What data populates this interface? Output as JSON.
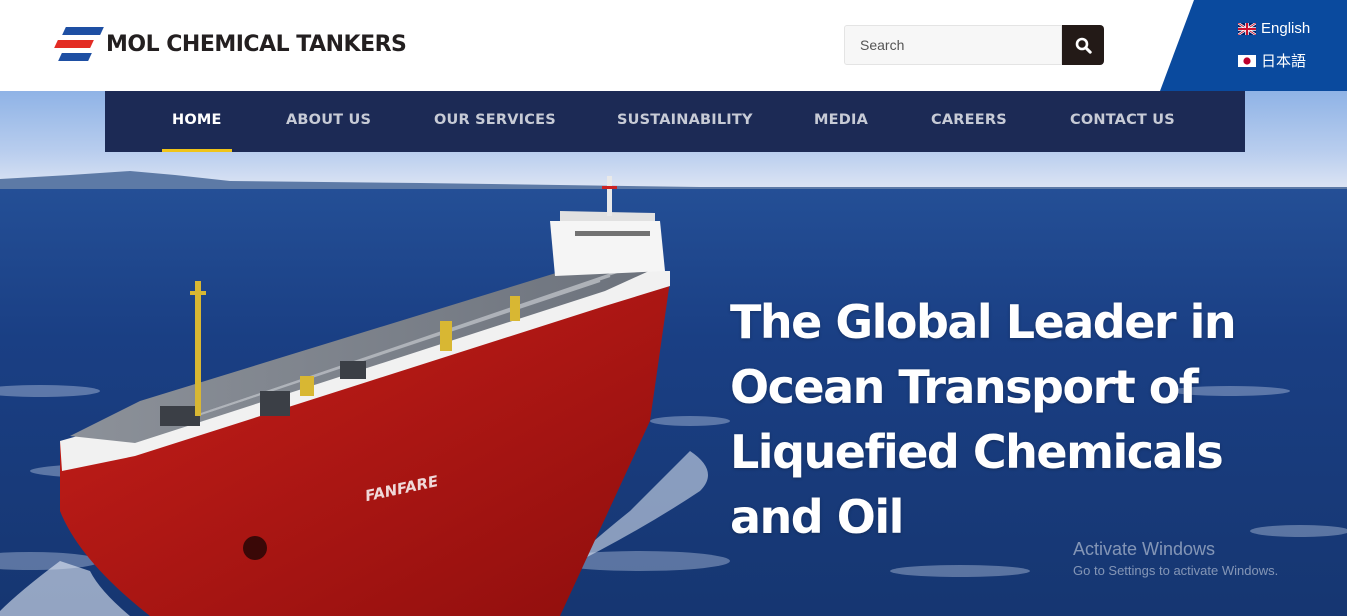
{
  "brand": {
    "name": "MOL CHEMICAL TANKERS",
    "colors": {
      "navy": "#1c2a55",
      "blue": "#0a4a9e",
      "red": "#e32c24",
      "accent": "#f0c419"
    }
  },
  "search": {
    "placeholder": "Search",
    "icon": "search-icon"
  },
  "languages": [
    {
      "label": "English",
      "icon": "uk-flag-icon"
    },
    {
      "label": "日本語",
      "icon": "japan-flag-icon"
    }
  ],
  "nav": {
    "items": [
      {
        "label": "HOME",
        "active": true
      },
      {
        "label": "ABOUT US"
      },
      {
        "label": "OUR SERVICES"
      },
      {
        "label": "SUSTAINABILITY"
      },
      {
        "label": "MEDIA"
      },
      {
        "label": "CAREERS"
      },
      {
        "label": "CONTACT US"
      }
    ]
  },
  "hero": {
    "tagline_lines": [
      "The Global Leader in",
      "Ocean Transport of",
      "Liquefied Chemicals",
      "and Oil"
    ],
    "ship_name": "FANFARE"
  },
  "watermark": {
    "title": "Activate Windows",
    "subtitle": "Go to Settings to activate Windows."
  }
}
